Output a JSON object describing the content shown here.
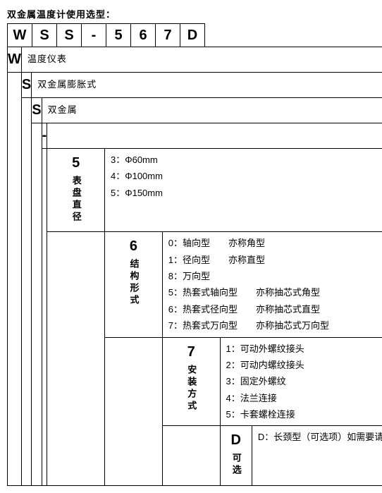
{
  "title": "双金属温度计使用选型：",
  "code": [
    "W",
    "S",
    "S",
    "-",
    "5",
    "6",
    "7",
    "D"
  ],
  "rows": {
    "w": {
      "head": "W",
      "label": "温度仪表"
    },
    "s1": {
      "head": "S",
      "label": "双金属膨胀式"
    },
    "s2": {
      "head": "S",
      "label": "双金属"
    },
    "dash": {
      "head": "-"
    },
    "dial": {
      "head": "5",
      "vlabel": "表盘直径",
      "items": [
        "3：Φ60mm",
        "4：Φ100mm",
        "5：Φ150mm"
      ]
    },
    "struct": {
      "head": "6",
      "vlabel": "结构形式",
      "items": [
        "0：轴向型　　亦称角型",
        "1：径向型　　亦称直型",
        "8：万向型",
        "5：热套式轴向型　　亦称抽芯式角型",
        "6：热套式径向型　　亦称抽芯式直型",
        "7：热套式万向型　　亦称抽芯式万向型"
      ]
    },
    "install": {
      "head": "7",
      "vlabel": "安装方式",
      "items": [
        "1：可动外螺纹接头",
        "2：可动内螺纹接头",
        "3：固定外螺纹",
        "4：法兰连接",
        "5：卡套螺栓连接"
      ]
    },
    "opt": {
      "head": "D",
      "vlabel": "可选",
      "text": "D：长颈型（可选项）如需要请告知长颈长度"
    }
  }
}
